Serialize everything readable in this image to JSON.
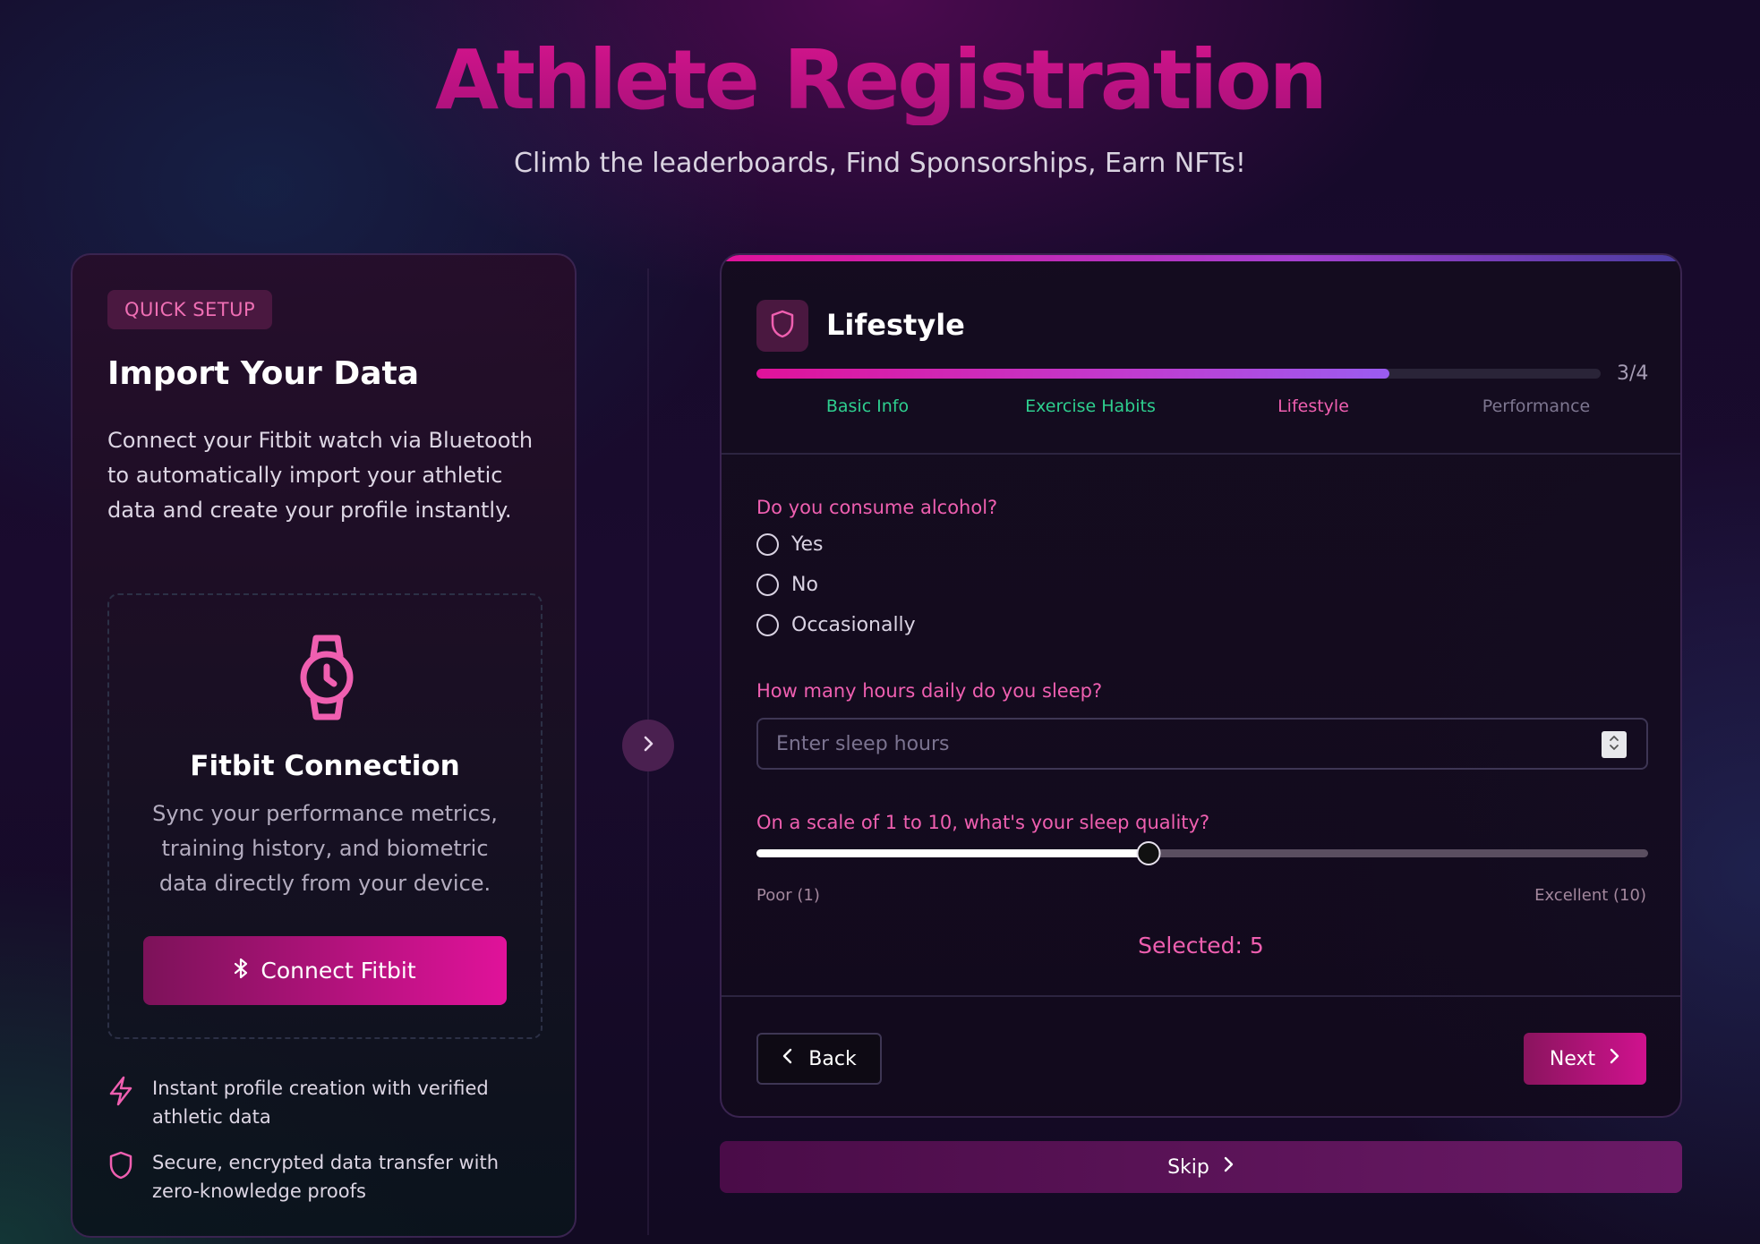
{
  "header": {
    "title": "Athlete Registration",
    "subtitle": "Climb the leaderboards, Find Sponsorships, Earn NFTs!"
  },
  "quick_setup": {
    "badge": "QUICK SETUP",
    "title": "Import Your Data",
    "description": "Connect your Fitbit watch via Bluetooth to automatically import your athletic data and create your profile instantly.",
    "fitbit": {
      "icon": "watch-icon",
      "title": "Fitbit Connection",
      "description": "Sync your performance metrics, training history, and biometric data directly from your device.",
      "button_label": "Connect Fitbit",
      "button_icon": "bluetooth-icon"
    },
    "features": [
      {
        "icon": "lightning-icon",
        "text": "Instant profile creation with verified athletic data"
      },
      {
        "icon": "shield-icon",
        "text": "Secure, encrypted data transfer with zero-knowledge proofs"
      }
    ]
  },
  "form": {
    "section_icon": "shield-icon",
    "section_title": "Lifestyle",
    "progress": {
      "current": 3,
      "total": 4,
      "label": "3/4",
      "fraction": 0.75
    },
    "steps": [
      {
        "label": "Basic Info",
        "state": "done"
      },
      {
        "label": "Exercise Habits",
        "state": "done"
      },
      {
        "label": "Lifestyle",
        "state": "active"
      },
      {
        "label": "Performance",
        "state": "todo"
      }
    ],
    "alcohol": {
      "question": "Do you consume alcohol?",
      "options": [
        "Yes",
        "No",
        "Occasionally"
      ]
    },
    "sleep_hours": {
      "question": "How many hours daily do you sleep?",
      "placeholder": "Enter sleep hours",
      "value": ""
    },
    "sleep_quality": {
      "question": "On a scale of 1 to 10, what's your sleep quality?",
      "min": 1,
      "max": 10,
      "value": 5,
      "min_label": "Poor (1)",
      "max_label": "Excellent (10)",
      "selected_text": "Selected: 5"
    },
    "back_label": "Back",
    "next_label": "Next",
    "skip_label": "Skip"
  },
  "colors": {
    "accent": "#e0129a",
    "accent_text": "#ef5fb0",
    "done": "#2ecf8f",
    "todo": "#7d7690"
  }
}
